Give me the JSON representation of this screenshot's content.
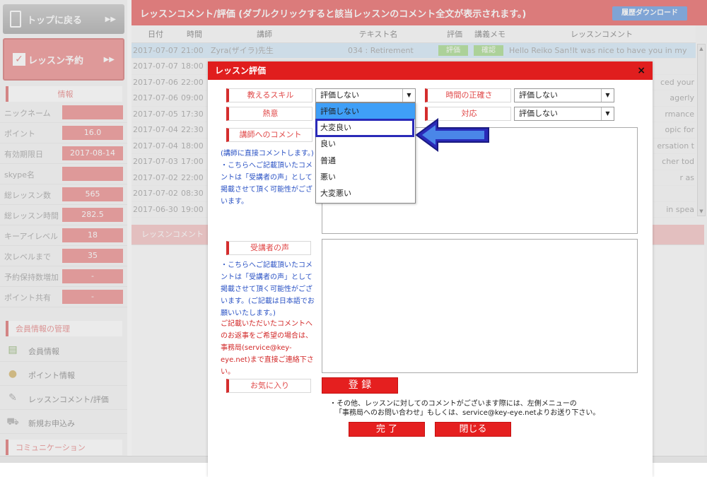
{
  "sidebar": {
    "top_button": "トップに戻る",
    "reserve_button": "レッスン予約",
    "info_heading": "情報",
    "info": [
      {
        "label": "ニックネーム",
        "value": ""
      },
      {
        "label": "ポイント",
        "value": "16.0"
      },
      {
        "label": "有効期限日",
        "value": "2017-08-14"
      },
      {
        "label": "skype名",
        "value": ""
      },
      {
        "label": "総レッスン数",
        "value": "565"
      },
      {
        "label": "総レッスン時間",
        "value": "282.5"
      },
      {
        "label": "キーアイレベル",
        "value": "18"
      },
      {
        "label": "次レベルまで",
        "value": "35"
      },
      {
        "label": "予約保持数増加",
        "value": "-"
      },
      {
        "label": "ポイント共有",
        "value": "-"
      }
    ],
    "member_heading": "会員情報の管理",
    "menu": [
      {
        "icon": "member-card-icon",
        "label": "会員情報"
      },
      {
        "icon": "coins-icon",
        "label": "ポイント情報"
      },
      {
        "icon": "pencil-note-icon",
        "label": "レッスンコメント/評価"
      },
      {
        "icon": "cart-icon",
        "label": "新規お申込み"
      }
    ],
    "communication_heading": "コミュニケーション"
  },
  "main": {
    "title": "レッスンコメント/評価 (ダブルクリックすると該当レッスンのコメント全文が表示されます。)",
    "download_button": "履歴ダウンロード",
    "columns": [
      "日付",
      "時間",
      "講師",
      "テキスト名",
      "評価",
      "講義メモ",
      "レッスンコメント"
    ],
    "rows": [
      {
        "date": "2017-07-07",
        "time": "21:00",
        "teacher": "Zyra(ザイラ)先生",
        "text": "034 : Retirement",
        "rate": "評価",
        "memo": "確認",
        "comment": "Hello Reiko San!It was nice to have you in my"
      },
      {
        "date": "2017-07-07",
        "time": "18:00",
        "comment": ""
      },
      {
        "date": "2017-07-06",
        "time": "22:00",
        "comment": "ced your"
      },
      {
        "date": "2017-07-06",
        "time": "09:00",
        "comment": "agerly"
      },
      {
        "date": "2017-07-05",
        "time": "17:30",
        "comment": "rmance"
      },
      {
        "date": "2017-07-04",
        "time": "22:30",
        "comment": "opic for"
      },
      {
        "date": "2017-07-04",
        "time": "18:00",
        "comment": "ersation t"
      },
      {
        "date": "2017-07-03",
        "time": "17:00",
        "comment": "cher tod"
      },
      {
        "date": "2017-07-02",
        "time": "22:00",
        "comment": "r as"
      },
      {
        "date": "2017-07-02",
        "time": "08:30",
        "comment": ""
      },
      {
        "date": "2017-06-30",
        "time": "19:00",
        "comment": "in spea"
      }
    ],
    "comment_heading": "レッスンコメント"
  },
  "modal": {
    "title": "レッスン評価",
    "close": "×",
    "skill_label": "教えるスキル",
    "skill_value": "評価しない",
    "enthusiasm_label": "熱意",
    "punctuality_label": "時間の正確さ",
    "punctuality_value": "評価しない",
    "response_label": "対応",
    "response_value": "評価しない",
    "teacher_comment_label": "講師へのコメント",
    "teacher_comment_note": "(講師に直接コメントします。)\n・こちらへご記載頂いたコメントは「受講者の声」として掲載させて頂く可能性がございます。",
    "voice_label": "受講者の声",
    "voice_note_blue": "・こちらへご記載頂いたコメントは「受講者の声」として掲載させて頂く可能性がございます。(ご記載は日本語でお願いいたします。)",
    "voice_note_red": "ご記載いただいたコメントへのお返事をご希望の場合は、事務局(service@key-eye.net)まで直接ご連絡下さい。",
    "favorite_label": "お気に入り",
    "register_button": "登 録",
    "footer_note_1": "・その他、レッスンに対してのコメントがございます際には、左側メニューの",
    "footer_note_2": "「事務局へのお問い合わせ」もしくは、service@key-eye.netよりお送り下さい。",
    "complete_button": "完 了",
    "close_button": "閉じる"
  },
  "dropdown": {
    "options": [
      "評価しない",
      "大変良い",
      "良い",
      "普通",
      "悪い",
      "大変悪い"
    ],
    "selected": "評価しない",
    "highlighted": "大変良い"
  },
  "colors": {
    "accent": "#e01e1e",
    "pointer": "#2a2ab8",
    "selected_option": "#3f9ff7"
  }
}
